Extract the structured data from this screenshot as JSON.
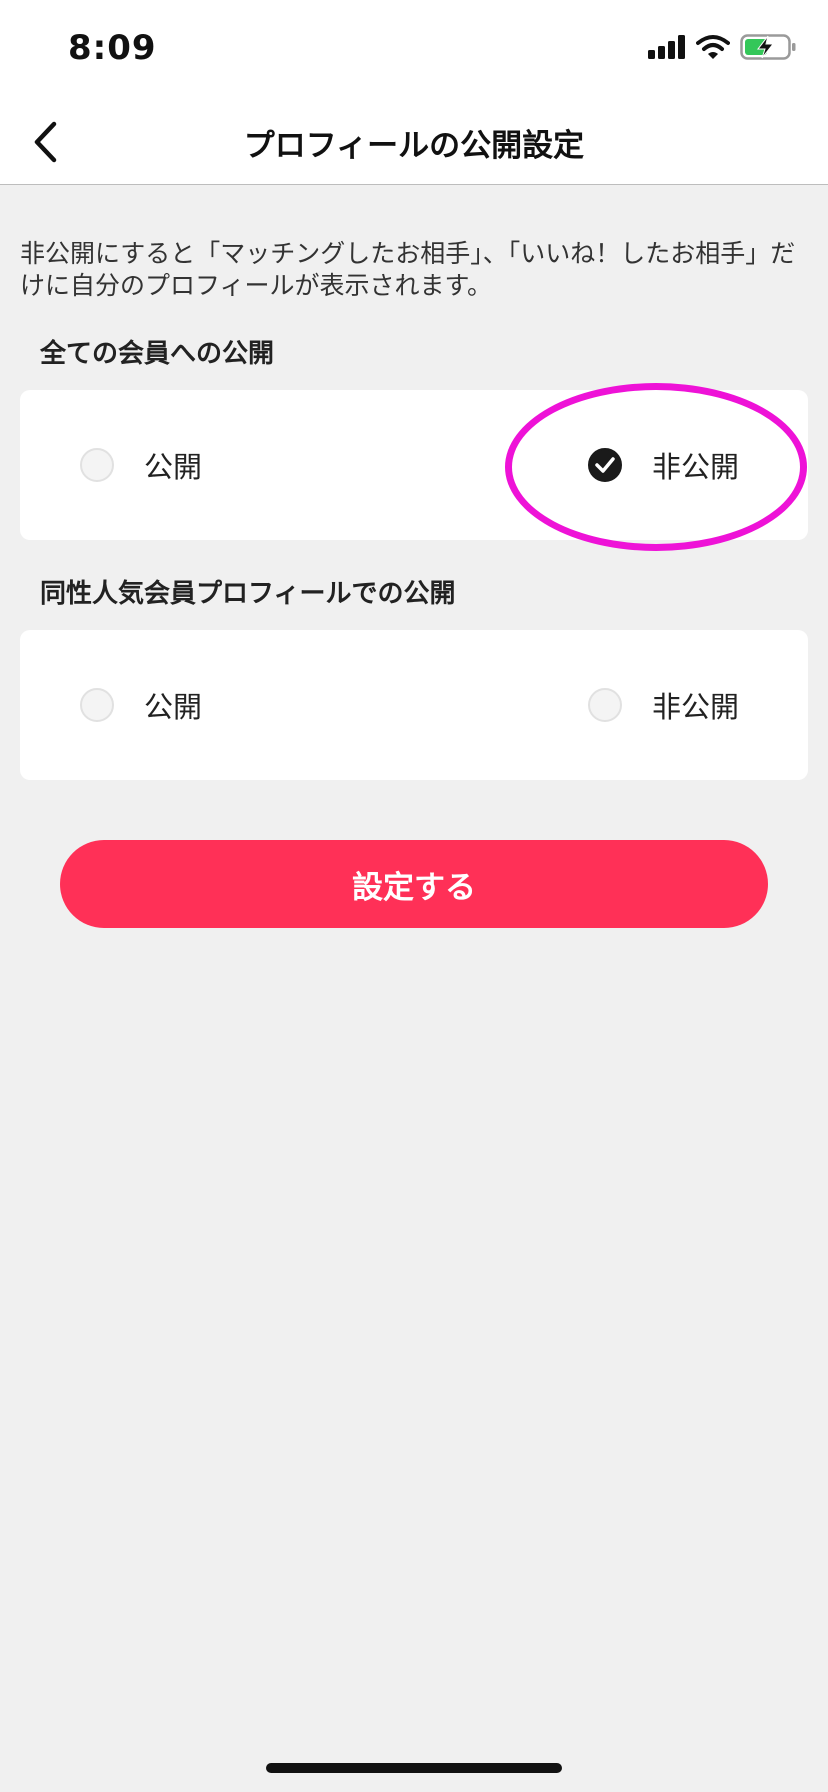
{
  "status_bar": {
    "time": "8:09",
    "icons": [
      "signal-icon",
      "wifi-icon",
      "battery-charging-icon"
    ]
  },
  "nav": {
    "title": "プロフィールの公開設定",
    "back_icon": "chevron-left-icon"
  },
  "description": "非公開にすると「マッチングしたお相手」、「いいね！したお相手」だけに自分のプロフィールが表示されます。",
  "sections": [
    {
      "title": "全ての会員への公開",
      "options": [
        {
          "label": "公開",
          "selected": false
        },
        {
          "label": "非公開",
          "selected": true
        }
      ]
    },
    {
      "title": "同性人気会員プロフィールでの公開",
      "options": [
        {
          "label": "公開",
          "selected": false
        },
        {
          "label": "非公開",
          "selected": false
        }
      ]
    }
  ],
  "submit_label": "設定する",
  "colors": {
    "accent": "#ff3057",
    "highlight": "#ee12d7",
    "background": "#f0f0f0",
    "card": "#ffffff",
    "checked": "#1a1a1a"
  }
}
